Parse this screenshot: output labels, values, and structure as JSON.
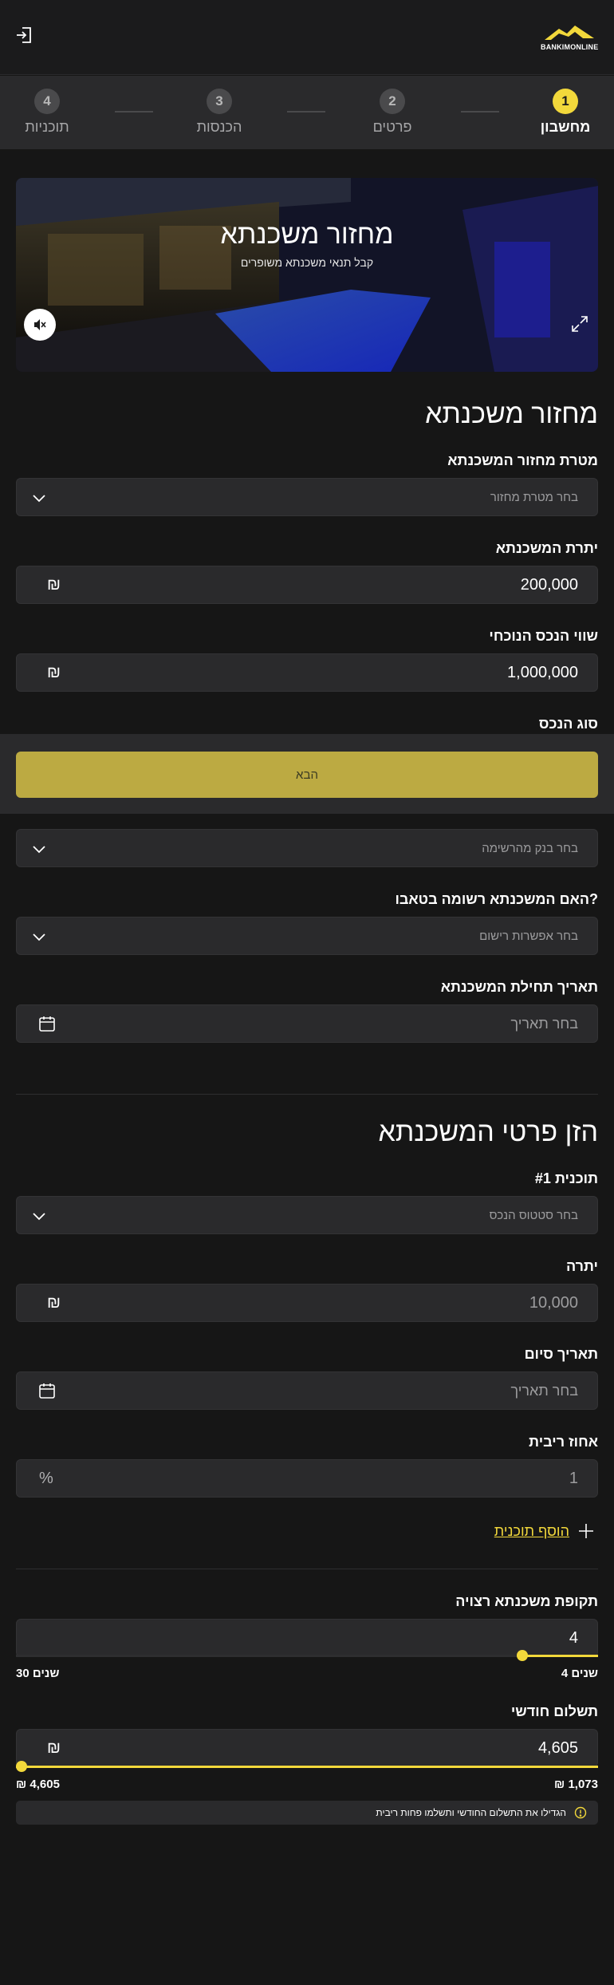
{
  "header": {
    "logo_text": "BANKIMONLINE",
    "logout_icon": "logout-icon"
  },
  "stepper": {
    "steps": [
      {
        "number": "1",
        "label": "מחשבון",
        "active": true
      },
      {
        "number": "2",
        "label": "פרטים",
        "active": false
      },
      {
        "number": "3",
        "label": "הכנסות",
        "active": false
      },
      {
        "number": "4",
        "label": "תוכניות",
        "active": false
      }
    ]
  },
  "hero": {
    "title": "מחזור משכנתא",
    "subtitle": "קבל תנאי משכנתא משופרים",
    "mute_icon": "mute-icon",
    "expand_icon": "expand-icon"
  },
  "form": {
    "title": "מחזור משכנתא",
    "purpose": {
      "label": "מטרת מחזור המשכנתא",
      "placeholder": "בחר מטרת מחזור"
    },
    "balance": {
      "label": "יתרת המשכנתא",
      "value": "200,000",
      "unit": "₪"
    },
    "property_value": {
      "label": "שווי הנכס הנוכחי",
      "value": "1,000,000",
      "unit": "₪"
    },
    "property_type": {
      "label": "סוג הנכס"
    },
    "bank": {
      "placeholder": "בחר בנק מהרשימה"
    },
    "registered": {
      "label": "האם המשכנתא רשומה בטאבו?",
      "placeholder": "בחר אפשרות רישום"
    },
    "start_date": {
      "label": "תאריך תחילת המשכנתא",
      "placeholder": "בחר תאריך"
    }
  },
  "next_button": {
    "label": "הבא"
  },
  "details": {
    "title": "הזן פרטי המשכנתא",
    "plan": {
      "label": "תוכנית #1",
      "placeholder": "בחר סטטוס הנכס"
    },
    "remaining": {
      "label": "יתרה",
      "value": "10,000",
      "unit": "₪"
    },
    "end_date": {
      "label": "תאריך סיום",
      "placeholder": "בחר תאריך"
    },
    "interest": {
      "label": "אחוז ריבית",
      "value": "1",
      "unit": "%"
    },
    "add_plan": "הוסף תוכנית"
  },
  "period": {
    "label": "תקופת משכנתא רצויה",
    "value": "4",
    "min_label": "4 שנים",
    "max_label": "30 שנים",
    "fraction": 0.13
  },
  "monthly": {
    "label": "תשלום חודשי",
    "value": "4,605",
    "unit": "₪",
    "min_label": "₪ 1,073",
    "max_label": "₪ 4,605",
    "fraction": 1.0
  },
  "tip": {
    "text": "הגדילו את התשלום החודשי ותשלמו פחות ריבית"
  },
  "colors": {
    "accent": "#f2d83b",
    "background": "#161616",
    "field": "#2a2a2c",
    "button": "#bcaa42"
  }
}
